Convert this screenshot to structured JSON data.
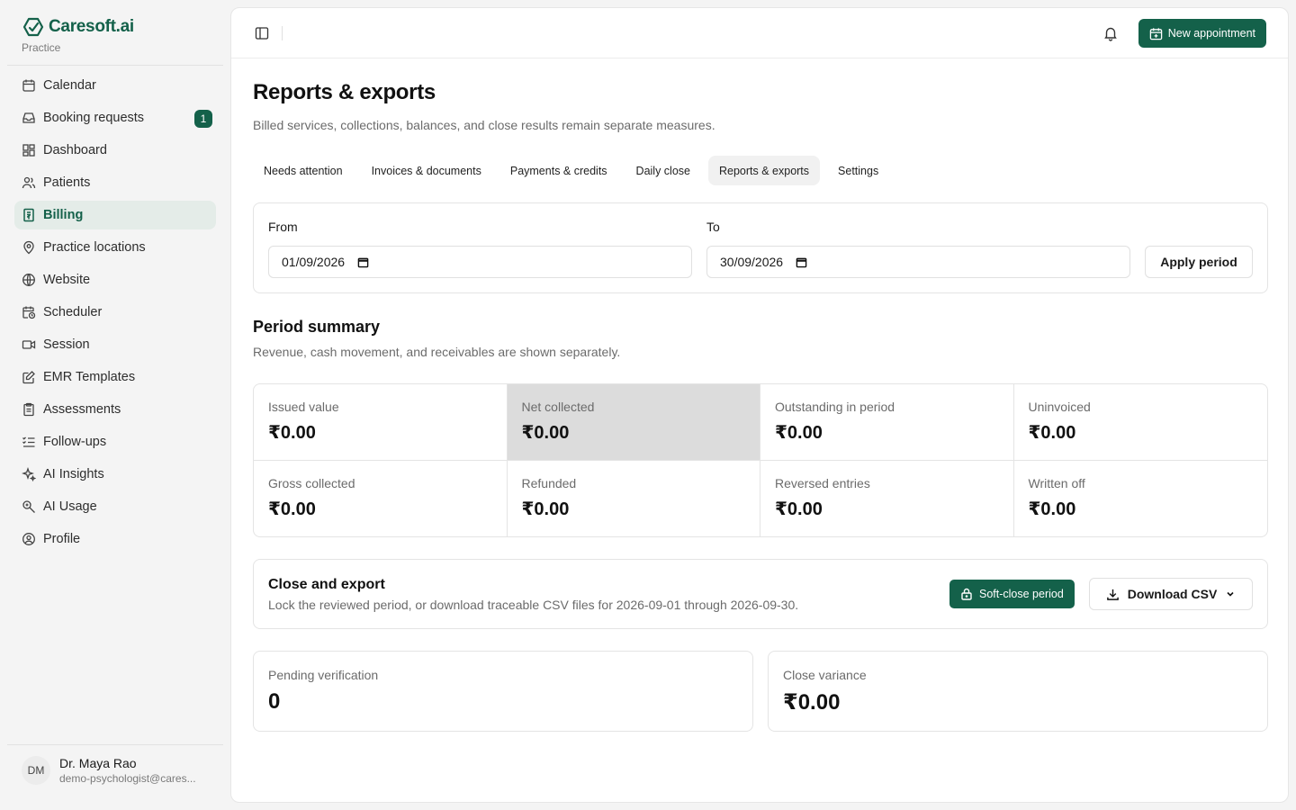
{
  "brand": {
    "name": "Caresoft.ai",
    "subtitle": "Practice"
  },
  "sidebar": {
    "items": [
      {
        "label": "Calendar",
        "icon": "calendar-icon"
      },
      {
        "label": "Booking requests",
        "icon": "inbox-icon",
        "badge": "1"
      },
      {
        "label": "Dashboard",
        "icon": "dashboard-icon"
      },
      {
        "label": "Patients",
        "icon": "users-icon"
      },
      {
        "label": "Billing",
        "icon": "receipt-icon",
        "active": true
      },
      {
        "label": "Practice locations",
        "icon": "map-pin-icon"
      },
      {
        "label": "Website",
        "icon": "globe-icon"
      },
      {
        "label": "Scheduler",
        "icon": "calendar-clock-icon"
      },
      {
        "label": "Session",
        "icon": "video-icon"
      },
      {
        "label": "EMR Templates",
        "icon": "edit-icon"
      },
      {
        "label": "Assessments",
        "icon": "clipboard-icon"
      },
      {
        "label": "Follow-ups",
        "icon": "list-checks-icon"
      },
      {
        "label": "AI Insights",
        "icon": "sparkles-icon"
      },
      {
        "label": "AI Usage",
        "icon": "ai-usage-icon"
      },
      {
        "label": "Profile",
        "icon": "user-circle-icon"
      }
    ]
  },
  "user": {
    "initials": "DM",
    "name": "Dr. Maya Rao",
    "email": "demo-psychologist@cares..."
  },
  "topbar": {
    "new_appointment": "New appointment"
  },
  "page": {
    "title": "Reports & exports",
    "subtitle": "Billed services, collections, balances, and close results remain separate measures."
  },
  "tabs": [
    {
      "label": "Needs attention"
    },
    {
      "label": "Invoices & documents"
    },
    {
      "label": "Payments & credits"
    },
    {
      "label": "Daily close"
    },
    {
      "label": "Reports & exports",
      "active": true
    },
    {
      "label": "Settings"
    }
  ],
  "period": {
    "from_label": "From",
    "from_value": "01/09/2026",
    "to_label": "To",
    "to_value": "30/09/2026",
    "apply": "Apply period"
  },
  "summary": {
    "title": "Period summary",
    "subtitle": "Revenue, cash movement, and receivables are shown separately.",
    "metrics": [
      {
        "label": "Issued value",
        "value": "₹0.00"
      },
      {
        "label": "Net collected",
        "value": "₹0.00",
        "highlight": true
      },
      {
        "label": "Outstanding in period",
        "value": "₹0.00"
      },
      {
        "label": "Uninvoiced",
        "value": "₹0.00"
      },
      {
        "label": "Gross collected",
        "value": "₹0.00"
      },
      {
        "label": "Refunded",
        "value": "₹0.00"
      },
      {
        "label": "Reversed entries",
        "value": "₹0.00"
      },
      {
        "label": "Written off",
        "value": "₹0.00"
      }
    ]
  },
  "close": {
    "title": "Close and export",
    "description": "Lock the reviewed period, or download traceable CSV files for 2026-09-01 through 2026-09-30.",
    "soft_close": "Soft-close period",
    "download": "Download CSV"
  },
  "pending": {
    "label": "Pending verification",
    "value": "0"
  },
  "variance": {
    "label": "Close variance",
    "value": "₹0.00"
  },
  "colors": {
    "accent": "#14614a",
    "active_bg": "#e4ece8",
    "highlight_cell": "#dcdcdc"
  }
}
